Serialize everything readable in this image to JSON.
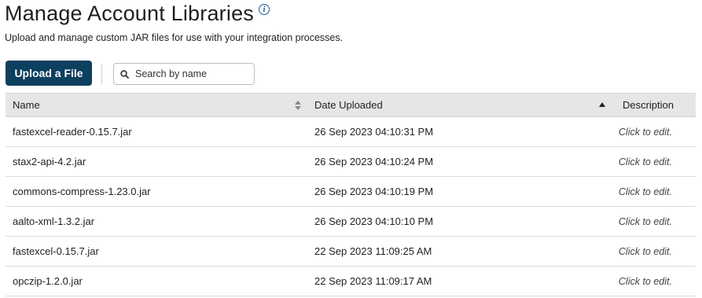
{
  "header": {
    "title": "Manage Account Libraries",
    "subtitle": "Upload and manage custom JAR files for use with your integration processes.",
    "info_icon": "info-icon"
  },
  "toolbar": {
    "upload_label": "Upload a File",
    "search_placeholder": "Search by name",
    "search_value": ""
  },
  "table": {
    "columns": {
      "name": "Name",
      "date": "Date Uploaded",
      "description": "Description"
    },
    "sort": {
      "column": "Date Uploaded",
      "direction": "ascending-indicator"
    },
    "rows": [
      {
        "name": "fastexcel-reader-0.15.7.jar",
        "date": "26 Sep 2023 04:10:31 PM",
        "description": "Click to edit."
      },
      {
        "name": "stax2-api-4.2.jar",
        "date": "26 Sep 2023 04:10:24 PM",
        "description": "Click to edit."
      },
      {
        "name": "commons-compress-1.23.0.jar",
        "date": "26 Sep 2023 04:10:19 PM",
        "description": "Click to edit."
      },
      {
        "name": "aalto-xml-1.3.2.jar",
        "date": "26 Sep 2023 04:10:10 PM",
        "description": "Click to edit."
      },
      {
        "name": "fastexcel-0.15.7.jar",
        "date": "22 Sep 2023 11:09:25 AM",
        "description": "Click to edit."
      },
      {
        "name": "opczip-1.2.0.jar",
        "date": "22 Sep 2023 11:09:17 AM",
        "description": "Click to edit."
      }
    ]
  },
  "colors": {
    "primary_button": "#0d3f5f",
    "info_icon": "#1c5b99",
    "header_bg": "#e6e6e6"
  }
}
